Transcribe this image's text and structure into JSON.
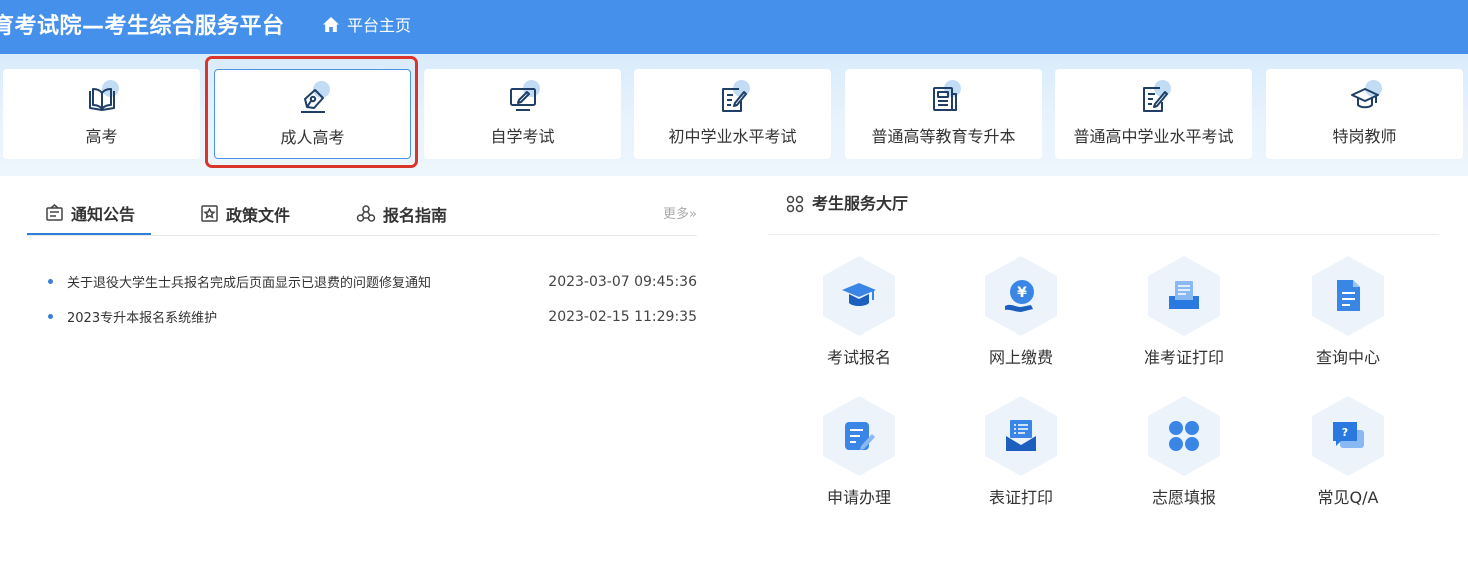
{
  "header": {
    "title": "育考试院—考生综合服务平台",
    "home_label": "平台主页"
  },
  "categories": [
    {
      "label": "高考",
      "icon": "book-icon"
    },
    {
      "label": "成人高考",
      "icon": "pen-icon"
    },
    {
      "label": "自学考试",
      "icon": "monitor-pen-icon"
    },
    {
      "label": "初中学业水平考试",
      "icon": "notebook-pen-icon"
    },
    {
      "label": "普通高等教育专升本",
      "icon": "newspaper-icon"
    },
    {
      "label": "普通高中学业水平考试",
      "icon": "document-edit-icon"
    },
    {
      "label": "特岗教师",
      "icon": "graduation-cap-icon"
    }
  ],
  "selected_category": "成人高考",
  "news": {
    "tabs": [
      {
        "label": "通知公告",
        "icon": "announcement-icon"
      },
      {
        "label": "政策文件",
        "icon": "policy-icon"
      },
      {
        "label": "报名指南",
        "icon": "guide-icon"
      }
    ],
    "active_tab": "通知公告",
    "more_label": "更多»",
    "items": [
      {
        "title": "关于退役大学生士兵报名完成后页面显示已退费的问题修复通知",
        "time": "2023-03-07 09:45:36"
      },
      {
        "title": "2023专升本报名系统维护",
        "time": "2023-02-15 11:29:35"
      }
    ]
  },
  "services": {
    "title": "考生服务大厅",
    "items": [
      {
        "label": "考试报名",
        "icon": "graduation-cap-icon"
      },
      {
        "label": "网上缴费",
        "icon": "yuan-payment-icon"
      },
      {
        "label": "准考证打印",
        "icon": "printer-icon"
      },
      {
        "label": "查询中心",
        "icon": "document-query-icon"
      },
      {
        "label": "申请办理",
        "icon": "form-edit-icon"
      },
      {
        "label": "表证打印",
        "icon": "envelope-print-icon"
      },
      {
        "label": "志愿填报",
        "icon": "clover-icon"
      },
      {
        "label": "常见Q/A",
        "icon": "qa-chat-icon"
      }
    ]
  },
  "colors": {
    "header_bg": "#4590ea",
    "accent": "#2f7fd8",
    "highlight": "#d9352b",
    "icon_blue": "#3a86e6"
  }
}
